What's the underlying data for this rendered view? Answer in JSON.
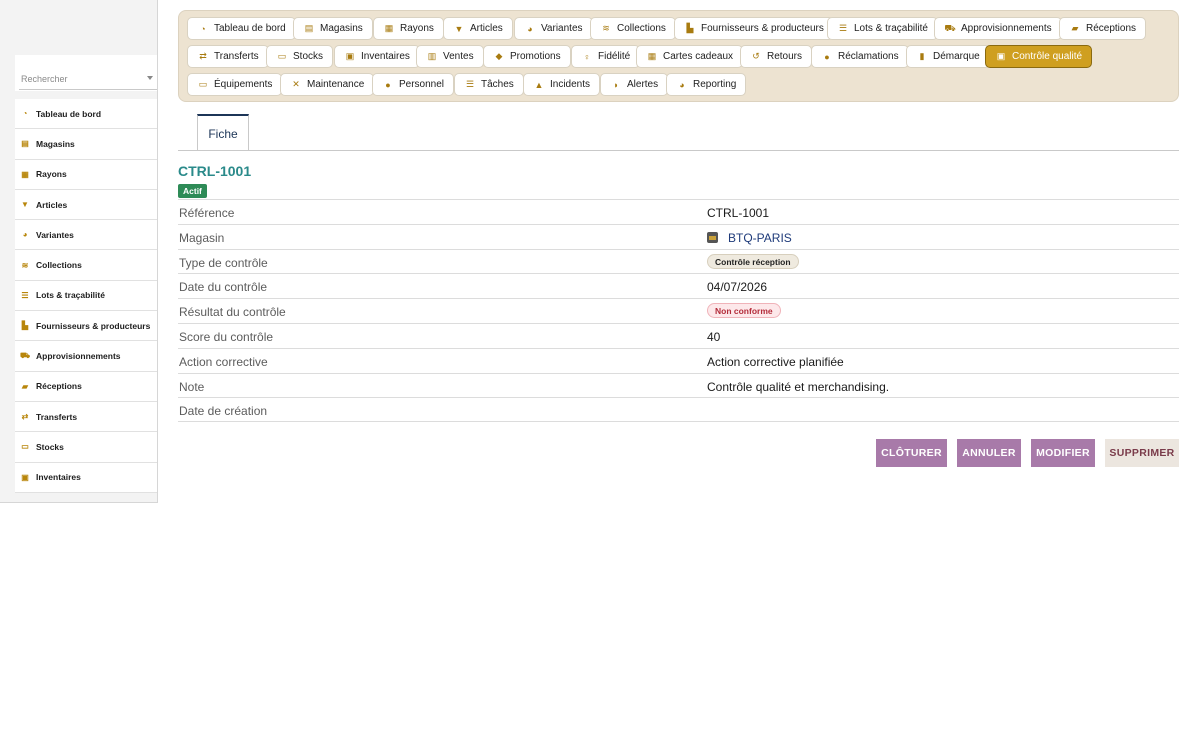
{
  "sidebar": {
    "search_placeholder": "Rechercher",
    "items": [
      {
        "label": "Tableau de bord",
        "icon": "dashboard-icon"
      },
      {
        "label": "Magasins",
        "icon": "store-icon"
      },
      {
        "label": "Rayons",
        "icon": "grid-icon"
      },
      {
        "label": "Articles",
        "icon": "shirt-icon"
      },
      {
        "label": "Variantes",
        "icon": "palette-icon"
      },
      {
        "label": "Collections",
        "icon": "layers-icon"
      },
      {
        "label": "Lots & traçabilité",
        "icon": "list-icon"
      },
      {
        "label": "Fournisseurs & producteurs",
        "icon": "factory-icon"
      },
      {
        "label": "Approvisionnements",
        "icon": "cart-icon"
      },
      {
        "label": "Réceptions",
        "icon": "truck-icon"
      },
      {
        "label": "Transferts",
        "icon": "transfer-icon"
      },
      {
        "label": "Stocks",
        "icon": "box-icon"
      },
      {
        "label": "Inventaires",
        "icon": "clipboard-icon"
      }
    ]
  },
  "topnav": {
    "items": [
      {
        "label": "Tableau de bord",
        "icon": "dashboard-icon"
      },
      {
        "label": "Magasins",
        "icon": "store-icon"
      },
      {
        "label": "Rayons",
        "icon": "grid-icon"
      },
      {
        "label": "Articles",
        "icon": "shirt-icon"
      },
      {
        "label": "Variantes",
        "icon": "palette-icon"
      },
      {
        "label": "Collections",
        "icon": "layers-icon"
      },
      {
        "label": "Fournisseurs & producteurs",
        "icon": "factory-icon"
      },
      {
        "label": "Lots & traçabilité",
        "icon": "list-icon"
      },
      {
        "label": "Approvisionnements",
        "icon": "cart-icon"
      },
      {
        "label": "Réceptions",
        "icon": "truck-icon"
      },
      {
        "label": "Transferts",
        "icon": "transfer-icon"
      },
      {
        "label": "Stocks",
        "icon": "box-icon"
      },
      {
        "label": "Inventaires",
        "icon": "clipboard-icon"
      },
      {
        "label": "Ventes",
        "icon": "register-icon"
      },
      {
        "label": "Promotions",
        "icon": "tag-icon"
      },
      {
        "label": "Fidélité",
        "icon": "award-icon"
      },
      {
        "label": "Cartes cadeaux",
        "icon": "gift-icon"
      },
      {
        "label": "Retours",
        "icon": "undo-icon"
      },
      {
        "label": "Réclamations",
        "icon": "comment-icon"
      },
      {
        "label": "Démarque",
        "icon": "trash-icon"
      },
      {
        "label": "Contrôle qualité",
        "icon": "clipboard-check-icon",
        "active": true
      },
      {
        "label": "Équipements",
        "icon": "monitor-icon"
      },
      {
        "label": "Maintenance",
        "icon": "tools-icon"
      },
      {
        "label": "Personnel",
        "icon": "users-icon"
      },
      {
        "label": "Tâches",
        "icon": "tasks-icon"
      },
      {
        "label": "Incidents",
        "icon": "warning-icon"
      },
      {
        "label": "Alertes",
        "icon": "bell-icon"
      },
      {
        "label": "Reporting",
        "icon": "pie-chart-icon"
      }
    ]
  },
  "tabs": [
    {
      "label": "Fiche",
      "active": true
    }
  ],
  "record": {
    "title": "CTRL-1001",
    "status": "Actif",
    "fields": [
      {
        "label": "Référence",
        "value": "CTRL-1001"
      },
      {
        "label": "Magasin",
        "value": "BTQ-PARIS"
      },
      {
        "label": "Type de contrôle",
        "value": "Contrôle réception"
      },
      {
        "label": "Date du contrôle",
        "value": "04/07/2026"
      },
      {
        "label": "Résultat du contrôle",
        "value": "Non conforme"
      },
      {
        "label": "Score du contrôle",
        "value": "40"
      },
      {
        "label": "Action corrective",
        "value": "Action corrective planifiée"
      },
      {
        "label": "Note",
        "value": "Contrôle qualité et merchandising."
      },
      {
        "label": "Date de création",
        "value": ""
      }
    ]
  },
  "actions": {
    "close": "CLÔTURER",
    "cancel": "ANNULER",
    "edit": "MODIFIER",
    "delete": "SUPPRIMER"
  },
  "colors": {
    "accent": "#cf9f20",
    "title": "#2a8a8a",
    "status": "#2e8b57",
    "button": "#a87aa9"
  }
}
